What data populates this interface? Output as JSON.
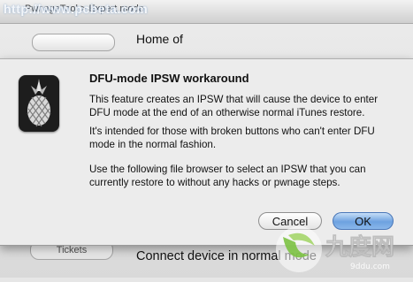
{
  "background_window": {
    "title": "PwnageTool > Expert mode",
    "top_label": "Home of",
    "bottom_button_label": "Tickets",
    "bottom_label": "Connect device in normal mode"
  },
  "dialog": {
    "title": "DFU-mode IPSW workaround",
    "paragraph1": "This feature creates an IPSW that will cause the device to enter DFU mode at the end of an otherwise normal iTunes restore.",
    "paragraph2": "It's intended for those with broken buttons who can't enter DFU mode in the normal fashion.",
    "paragraph3": "Use the following file browser to select an IPSW that you can currently restore to without any hacks or pwnage steps.",
    "cancel_label": "Cancel",
    "ok_label": "OK",
    "icon": "pineapple-icon"
  },
  "watermarks": {
    "top_left": "http://www.pcbeta.com",
    "bottom_right": "九度网",
    "bottom_right_sub": "9ddu.com"
  },
  "colors": {
    "ok_button": "#6da2e0",
    "dialog_bg": "#ececec",
    "logo_green": "#7cc242"
  }
}
